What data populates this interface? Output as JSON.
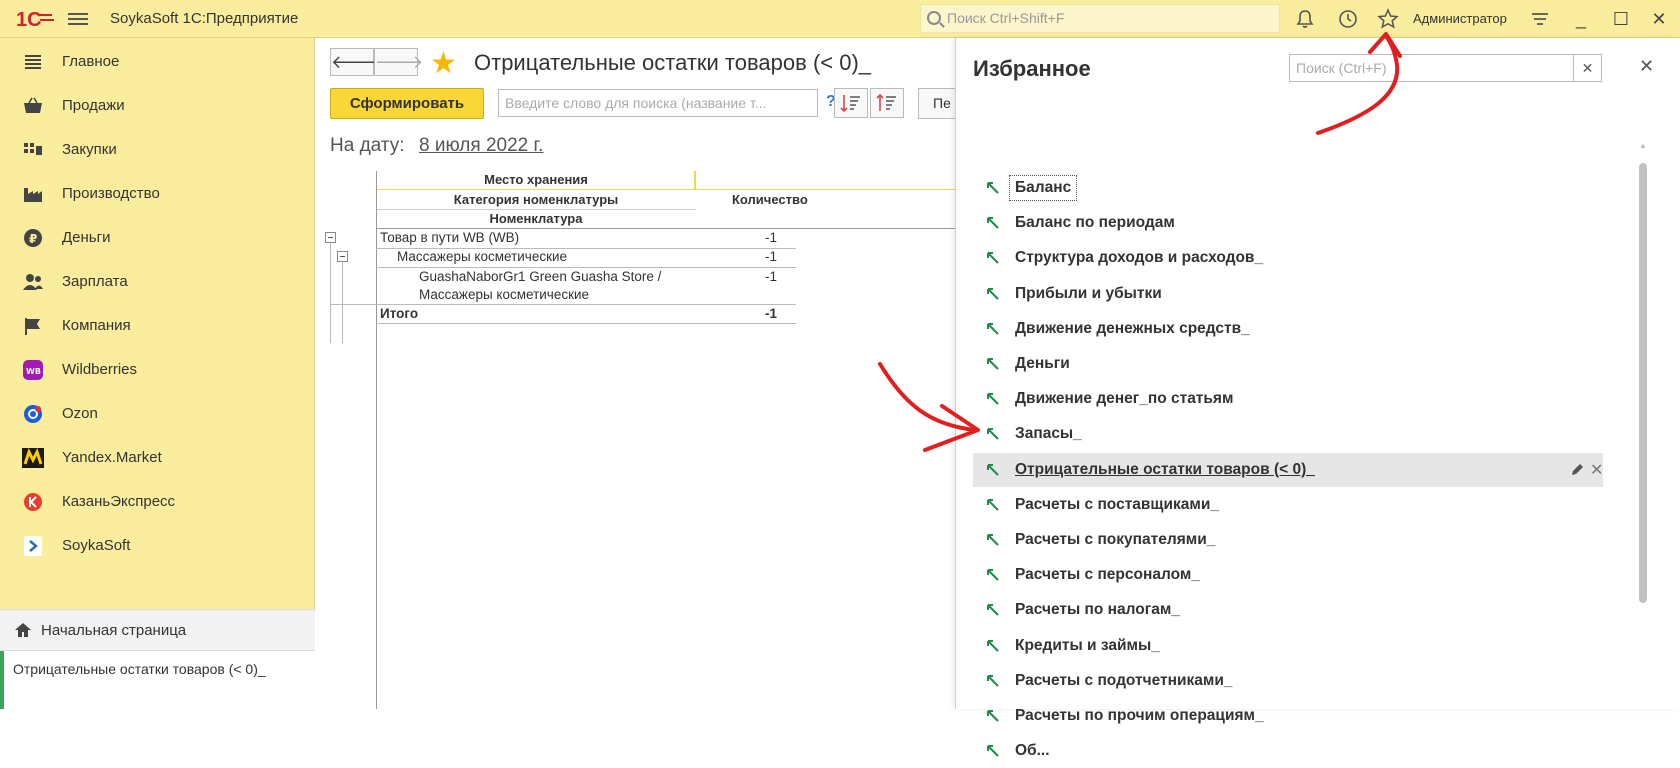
{
  "app": {
    "title": "SoykaSoft 1С:Предприятие",
    "search_placeholder": "Поиск Ctrl+Shift+F",
    "user": "Администратор",
    "accent_color": "#fbed9e",
    "logo_text": "1С"
  },
  "sidebar": {
    "items": [
      {
        "label": "Главное",
        "icon": "menu-list-icon"
      },
      {
        "label": "Продажи",
        "icon": "basket-icon"
      },
      {
        "label": "Закупки",
        "icon": "truck-icon"
      },
      {
        "label": "Производство",
        "icon": "factory-icon"
      },
      {
        "label": "Деньги",
        "icon": "ruble-icon"
      },
      {
        "label": "Зарплата",
        "icon": "people-icon"
      },
      {
        "label": "Компания",
        "icon": "flag-icon"
      },
      {
        "label": "Wildberries",
        "icon": "wildberries-icon"
      },
      {
        "label": "Ozon",
        "icon": "ozon-icon"
      },
      {
        "label": "Yandex.Market",
        "icon": "yandex-market-icon"
      },
      {
        "label": "КазаньЭкспресс",
        "icon": "kazanexpress-icon"
      },
      {
        "label": "SoykaSoft",
        "icon": "soykasoft-icon"
      }
    ],
    "home": "Начальная страница",
    "open_tab": "Отрицательные остатки товаров (< 0)_"
  },
  "report": {
    "title": "Отрицательные остатки товаров (< 0)_",
    "form_button": "Сформировать",
    "search_placeholder": "Введите слово для поиска (название т...",
    "help": "?",
    "cut_button": "Пе",
    "date_label": "На дату:",
    "date_value": "8 июля 2022 г.",
    "headers": {
      "storage": "Место хранения",
      "category": "Категория номенклатуры",
      "item": "Номенклатура",
      "quantity": "Количество"
    },
    "rows": [
      {
        "text": "Товар в пути WB (WB)",
        "value": "-1"
      },
      {
        "text": "Массажеры косметические",
        "value": "-1"
      },
      {
        "text": "GuashaNaborGr1 Green Guasha Store /",
        "text2": "Массажеры косметические",
        "value": "-1"
      }
    ],
    "total": {
      "label": "Итого",
      "value": "-1"
    }
  },
  "favorites": {
    "title": "Избранное",
    "search_placeholder": "Поиск (Ctrl+F)",
    "items": [
      "Баланс",
      "Баланс по периодам",
      "Структура доходов и расходов_",
      "Прибыли и убытки",
      "Движение денежных средств_",
      "Деньги",
      "Движение денег_по статьям",
      "Запасы_",
      "Отрицательные остатки товаров (< 0)_",
      "Расчеты с поставщиками_",
      "Расчеты с покупателями_",
      "Расчеты с персоналом_",
      "Расчеты по налогам_",
      "Кредиты и займы_",
      "Расчеты с подотчетниками_",
      "Расчеты по прочим операциям_",
      "Об..."
    ],
    "selected_index": 8
  }
}
